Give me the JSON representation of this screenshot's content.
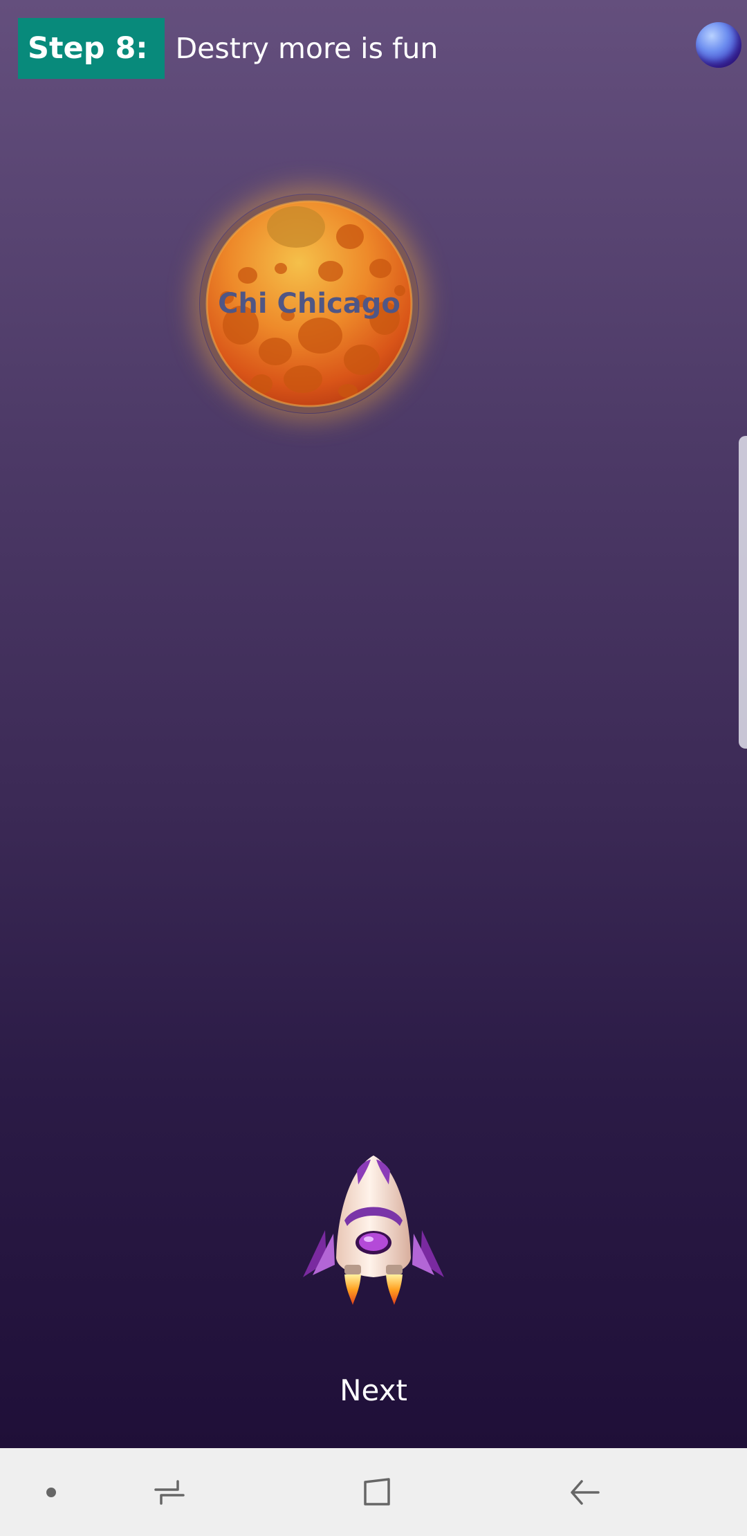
{
  "step": {
    "badge": "Step 8:",
    "text": "Destry more is fun"
  },
  "planet": {
    "label": "Chi Chicago"
  },
  "next_label": "Next",
  "icons": {
    "corner": "planet-icon",
    "target": "planet-target",
    "player": "rocket-ship",
    "nav": [
      "dot-icon",
      "recent-apps-icon",
      "home-icon",
      "back-icon"
    ]
  },
  "colors": {
    "badge": "#088a7b",
    "background_top": "#644f7d",
    "background_bottom": "#1f0f38",
    "planet_label": "#4f5685",
    "nav_bar": "#efefef"
  }
}
